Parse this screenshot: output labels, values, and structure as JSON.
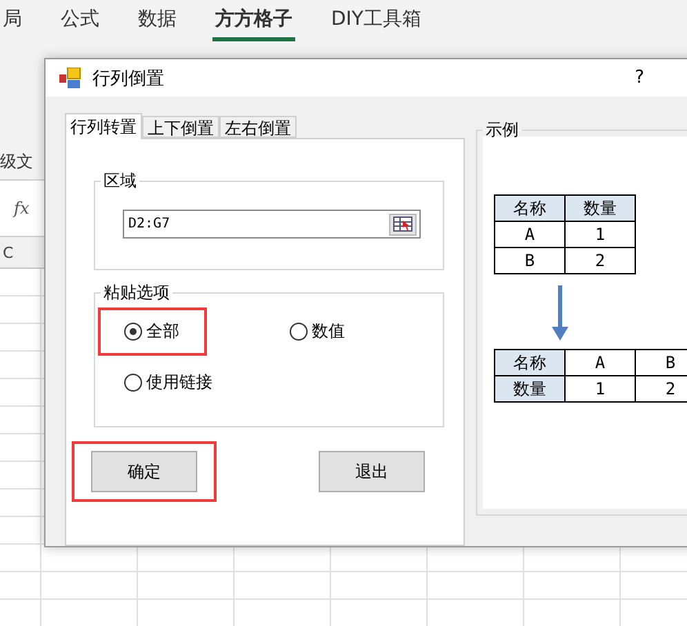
{
  "ribbon": {
    "tabs": [
      {
        "label": "局",
        "selected": false
      },
      {
        "label": "公式",
        "selected": false
      },
      {
        "label": "数据",
        "selected": false
      },
      {
        "label": "方方格子",
        "selected": true
      },
      {
        "label": "DIY工具箱",
        "selected": false
      }
    ]
  },
  "sheet": {
    "side_label": "级文",
    "formula_icon": "fx",
    "column_header": "C"
  },
  "dialog": {
    "title": "行列倒置",
    "help": "?",
    "tabs": [
      {
        "label": "行列转置",
        "selected": true
      },
      {
        "label": "上下倒置",
        "selected": false
      },
      {
        "label": "左右倒置",
        "selected": false
      }
    ],
    "range_group": {
      "title": "区域",
      "value": "D2:G7"
    },
    "paste_group": {
      "title": "粘贴选项",
      "options": [
        {
          "label": "全部",
          "selected": true,
          "highlighted": true
        },
        {
          "label": "数值",
          "selected": false,
          "highlighted": false
        },
        {
          "label": "使用链接",
          "selected": false,
          "highlighted": false
        }
      ]
    },
    "buttons": [
      {
        "label": "确定",
        "highlighted": true
      },
      {
        "label": "退出",
        "highlighted": false
      }
    ],
    "example": {
      "title": "示例",
      "tables": [
        {
          "rows": [
            [
              {
                "text": "名称",
                "header": true
              },
              {
                "text": "数量",
                "header": true
              }
            ],
            [
              {
                "text": "A",
                "header": false
              },
              {
                "text": "1",
                "header": false
              }
            ],
            [
              {
                "text": "B",
                "header": false
              },
              {
                "text": "2",
                "header": false
              }
            ]
          ]
        },
        {
          "rows": [
            [
              {
                "text": "名称",
                "header": true
              },
              {
                "text": "A",
                "header": false
              },
              {
                "text": "B",
                "header": false
              }
            ],
            [
              {
                "text": "数量",
                "header": true
              },
              {
                "text": "1",
                "header": false
              },
              {
                "text": "2",
                "header": false
              }
            ]
          ]
        }
      ]
    }
  }
}
